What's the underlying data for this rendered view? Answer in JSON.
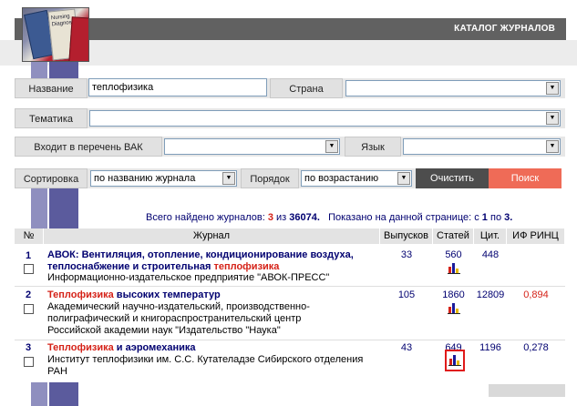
{
  "header": {
    "title": "КАТАЛОГ ЖУРНАЛОВ"
  },
  "book_image": {
    "spine_text": "Nursing Diagnosis"
  },
  "form": {
    "name_label": "Название",
    "name_value": "теплофизика",
    "country_label": "Страна",
    "country_value": "",
    "topic_label": "Тематика",
    "topic_value": "",
    "vak_label": "Входит в перечень ВАК",
    "vak_value": "",
    "language_label": "Язык",
    "language_value": "",
    "sort_label": "Сортировка",
    "sort_value": "по названию журнала",
    "order_label": "Порядок",
    "order_value": "по возрастанию",
    "clear_label": "Очистить",
    "search_label": "Поиск"
  },
  "summary": {
    "found_prefix": "Всего найдено журналов:",
    "found_count": "3",
    "of_word": "из",
    "total": "36074.",
    "shown_prefix": "Показано на данной странице: с",
    "from": "1",
    "to_word": "по",
    "to": "3."
  },
  "table": {
    "headers": {
      "no": "№",
      "journal": "Журнал",
      "issues": "Выпусков",
      "articles": "Статей",
      "cites": "Цит.",
      "if": "ИФ РИНЦ"
    },
    "rows": [
      {
        "no": "1",
        "title_pre": "АВОК: Вентиляция, отопление, кондиционирование воздуха, теплоснабжение и строительная ",
        "title_hl": "теплофизика",
        "title_post": "",
        "publisher": "Информационно-издательское предприятие \"АВОК-ПРЕСС\"",
        "issues": "33",
        "articles": "560",
        "cites": "448",
        "if": ""
      },
      {
        "no": "2",
        "title_pre": "",
        "title_hl": "Теплофизика",
        "title_post": " высоких температур",
        "publisher": "Академический научно-издательский, производственно-полиграфический и книгораспространительский центр Российской академии наук \"Издательство \"Наука\"",
        "issues": "105",
        "articles": "1860",
        "cites": "12809",
        "if": "0,894"
      },
      {
        "no": "3",
        "title_pre": "",
        "title_hl": "Теплофизика",
        "title_post": " и аэромеханика",
        "publisher": "Институт теплофизики им. С.С. Кутателадзе Сибирского отделения РАН",
        "issues": "43",
        "articles": "649",
        "cites": "1196",
        "if": "0,278"
      }
    ]
  },
  "colors": {
    "header_bg": "#616161",
    "accent_blue": "#000070",
    "highlight_red": "#d52218",
    "search_button": "#ef6b57",
    "clear_button": "#4d4d4d",
    "stripe_light": "#8f8fbf",
    "stripe_dark": "#5b5b9d"
  },
  "icons": {
    "dropdown": "chevron-down-icon",
    "stats": "bar-chart-icon",
    "checkbox": "checkbox-icon"
  }
}
